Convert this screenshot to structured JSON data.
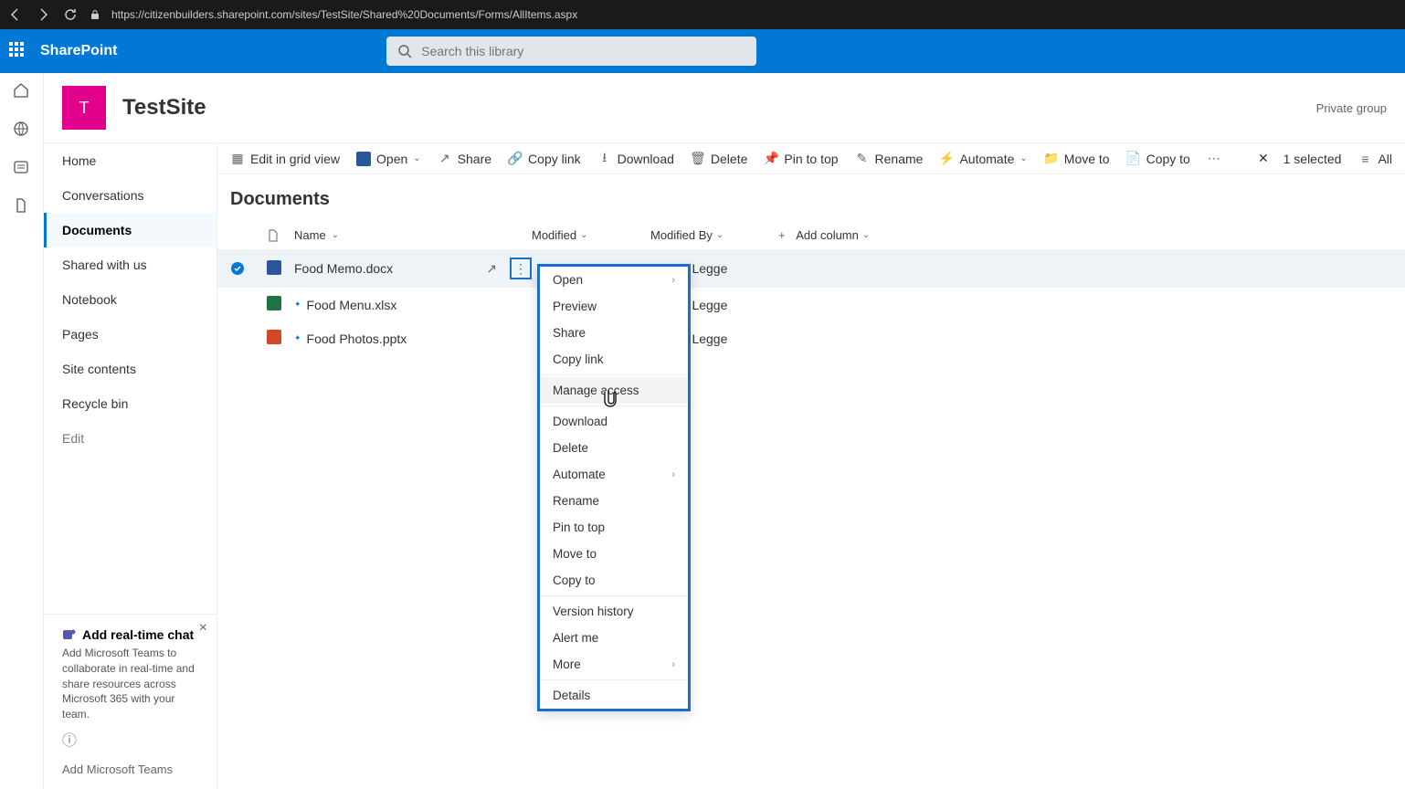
{
  "browser": {
    "url": "https://citizenbuilders.sharepoint.com/sites/TestSite/Shared%20Documents/Forms/AllItems.aspx"
  },
  "suite": {
    "title": "SharePoint",
    "search_placeholder": "Search this library"
  },
  "site": {
    "logo_letter": "T",
    "title": "TestSite",
    "privacy": "Private group"
  },
  "nav": {
    "items": [
      "Home",
      "Conversations",
      "Documents",
      "Shared with us",
      "Notebook",
      "Pages",
      "Site contents",
      "Recycle bin"
    ],
    "edit": "Edit",
    "active_index": 2
  },
  "promo": {
    "title": "Add real-time chat",
    "body": "Add Microsoft Teams to collaborate in real-time and share resources across Microsoft 365 with your team.",
    "link": "Add Microsoft Teams"
  },
  "cmd": {
    "grid": "Edit in grid view",
    "open": "Open",
    "share": "Share",
    "copylink": "Copy link",
    "download": "Download",
    "delete": "Delete",
    "pin": "Pin to top",
    "rename": "Rename",
    "automate": "Automate",
    "moveto": "Move to",
    "copyto": "Copy to",
    "selected": "1 selected",
    "all": "All"
  },
  "page": {
    "title": "Documents"
  },
  "cols": {
    "name": "Name",
    "modified": "Modified",
    "modified_by": "Modified By",
    "add": "Add column"
  },
  "rows": [
    {
      "name": "Food Memo.docx",
      "type": "word",
      "by": "Rory Legge",
      "selected": true
    },
    {
      "name": "Food Menu.xlsx",
      "type": "excel",
      "by": "Rory Legge",
      "selected": false
    },
    {
      "name": "Food Photos.pptx",
      "type": "ppt",
      "by": "Rory Legge",
      "selected": false
    }
  ],
  "ctx": {
    "open": "Open",
    "preview": "Preview",
    "share": "Share",
    "copylink": "Copy link",
    "manage": "Manage access",
    "download": "Download",
    "delete": "Delete",
    "automate": "Automate",
    "rename": "Rename",
    "pin": "Pin to top",
    "moveto": "Move to",
    "copyto": "Copy to",
    "version": "Version history",
    "alert": "Alert me",
    "more": "More",
    "details": "Details"
  }
}
